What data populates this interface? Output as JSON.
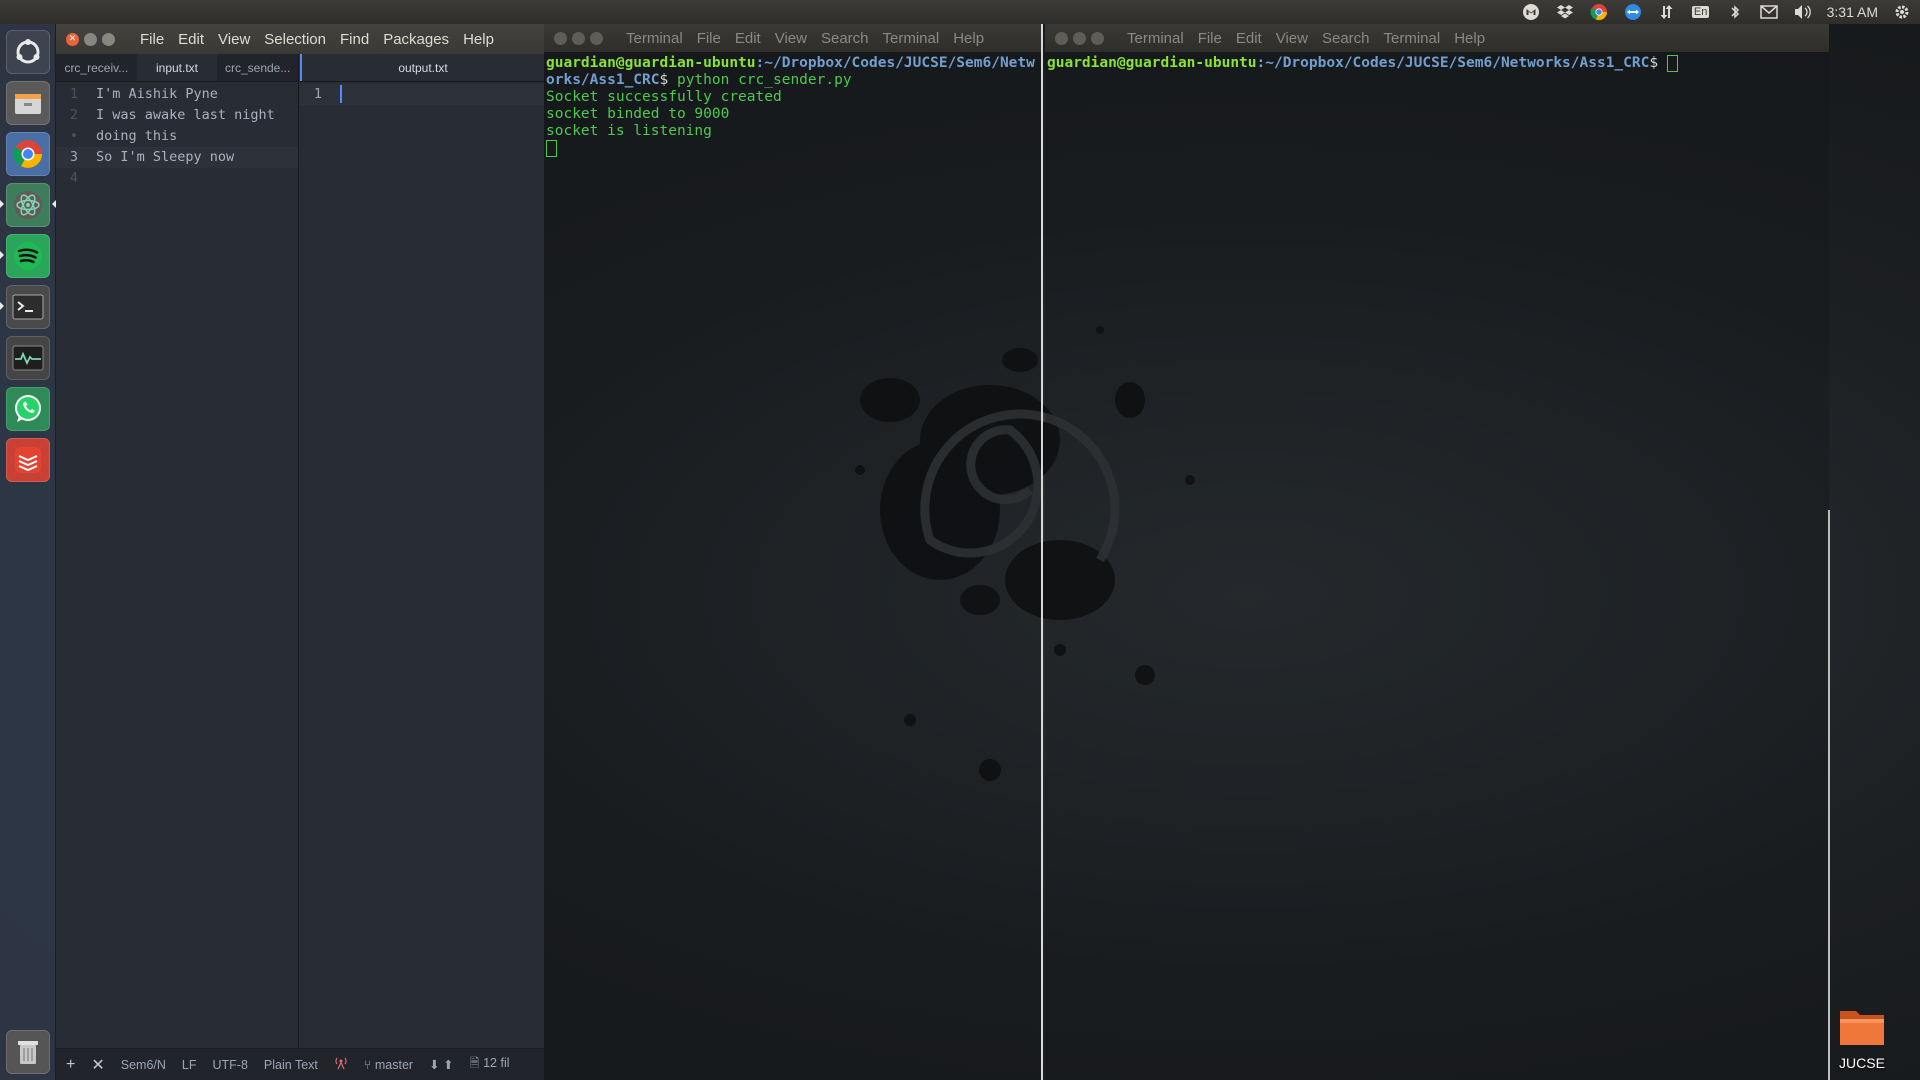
{
  "top_panel": {
    "tray_icons": [
      "gmail-icon",
      "dropbox-icon",
      "chrome-icon",
      "teamviewer-icon",
      "network-arrows-icon",
      "keyboard-en-icon",
      "bluetooth-icon",
      "mail-icon",
      "volume-icon"
    ],
    "keyboard_label": "En",
    "clock": "3:31 AM",
    "settings_icon": "gear-icon"
  },
  "launcher": {
    "items": [
      "ubuntu-search-icon",
      "files-icon",
      "chrome-icon",
      "atom-icon",
      "spotify-icon",
      "terminal-icon",
      "system-monitor-icon",
      "whatsapp-icon",
      "todoist-icon",
      "trash-icon"
    ]
  },
  "atom": {
    "menu": [
      "File",
      "Edit",
      "View",
      "Selection",
      "Find",
      "Packages",
      "Help"
    ],
    "left_tabs": [
      "crc_receiv...",
      "input.txt",
      "crc_sende..."
    ],
    "right_tab": "output.txt",
    "left_lines": [
      {
        "num": "1",
        "text": "I'm Aishik Pyne"
      },
      {
        "num": "2",
        "text": "I was awake last night"
      },
      {
        "num": "•",
        "text": "doing this"
      },
      {
        "num": "3",
        "text": "So I'm Sleepy now"
      },
      {
        "num": "4",
        "text": ""
      }
    ],
    "right_lines": [
      {
        "num": "1",
        "text": ""
      }
    ],
    "status": {
      "add": "+",
      "close": "✕",
      "path": "Sem6/N",
      "line_ending": "LF",
      "encoding": "UTF-8",
      "grammar": "Plain Text",
      "branch": "master",
      "files": "12 fil"
    },
    "accent": "#568af2"
  },
  "terminal1": {
    "menu": [
      "Terminal",
      "File",
      "Edit",
      "View",
      "Search",
      "Terminal",
      "Help"
    ],
    "prompt_user": "guardian@guardian-ubuntu",
    "prompt_path": ":~/Dropbox/Codes/JUCSE/Sem6/Networks/Ass1_CRC",
    "prompt_symbol": "$",
    "command": " python crc_sender.py",
    "output": [
      "Socket successfully created",
      "socket binded to 9000",
      "socket is listening"
    ]
  },
  "terminal2": {
    "menu": [
      "Terminal",
      "File",
      "Edit",
      "View",
      "Search",
      "Terminal",
      "Help"
    ],
    "prompt_user": "guardian@guardian-ubuntu",
    "prompt_path": ":~/Dropbox/Codes/JUCSE/Sem6/Networks/Ass1_CRC",
    "prompt_symbol": "$"
  },
  "desktop": {
    "folder_label": "JUCSE"
  }
}
